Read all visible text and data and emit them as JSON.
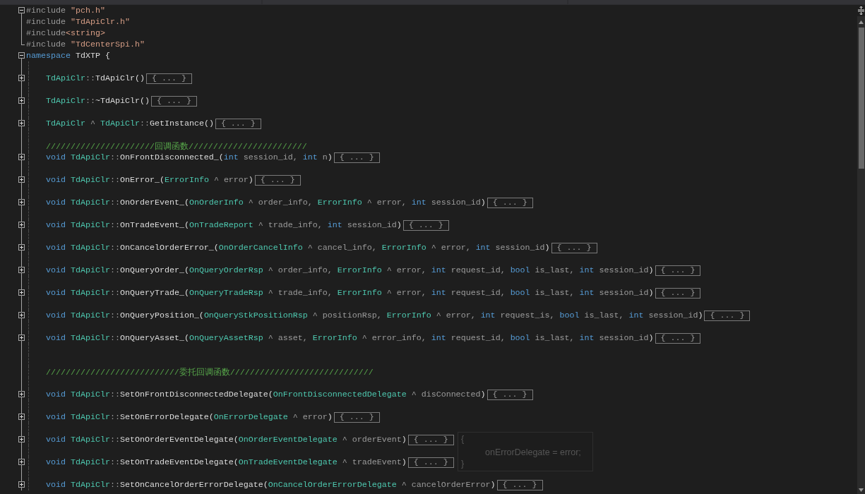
{
  "navigation_bar": {
    "dropdowns": [
      {
        "kind": "dropdown"
      },
      {
        "kind": "dropdown"
      },
      {
        "kind": "dropdown"
      }
    ]
  },
  "editor": {
    "lines": [
      {
        "kind": "fold",
        "expanded": true,
        "tokens": [
          {
            "kind": "directive",
            "text": "#include "
          },
          {
            "kind": "string",
            "text": "\"pch.h\""
          }
        ]
      },
      {
        "kind": "code",
        "tokens": [
          {
            "kind": "directive",
            "text": "#include "
          },
          {
            "kind": "string",
            "text": "\"TdApiClr.h\""
          }
        ]
      },
      {
        "kind": "code",
        "tokens": [
          {
            "kind": "directive",
            "text": "#include"
          },
          {
            "kind": "string",
            "text": "<string>"
          }
        ]
      },
      {
        "kind": "code",
        "tokens": [
          {
            "kind": "directive",
            "text": "#include "
          },
          {
            "kind": "string",
            "text": "\"TdCenterSpi.h\""
          }
        ]
      },
      {
        "kind": "fold",
        "expanded": true,
        "tokens": [
          {
            "kind": "keyword",
            "text": "namespace"
          },
          {
            "kind": "plain",
            "text": " TdXTP {"
          }
        ],
        "children": [
          {
            "kind": "blank"
          },
          {
            "kind": "fold",
            "expanded": false,
            "collapsed_text": "{ ... }",
            "tokens": [
              {
                "kind": "type",
                "text": "TdApiClr"
              },
              {
                "kind": "dim",
                "text": "::"
              },
              {
                "kind": "plain",
                "text": "TdApiClr()"
              }
            ]
          },
          {
            "kind": "blank"
          },
          {
            "kind": "fold",
            "expanded": false,
            "collapsed_text": "{ ... }",
            "tokens": [
              {
                "kind": "type",
                "text": "TdApiClr"
              },
              {
                "kind": "dim",
                "text": "::"
              },
              {
                "kind": "plain",
                "text": "~TdApiClr()"
              }
            ]
          },
          {
            "kind": "blank"
          },
          {
            "kind": "fold",
            "expanded": false,
            "collapsed_text": "{ ... }",
            "tokens": [
              {
                "kind": "type",
                "text": "TdApiClr"
              },
              {
                "kind": "dim",
                "text": " ^ "
              },
              {
                "kind": "type",
                "text": "TdApiClr"
              },
              {
                "kind": "dim",
                "text": "::"
              },
              {
                "kind": "plain",
                "text": "GetInstance()"
              }
            ]
          },
          {
            "kind": "blank"
          },
          {
            "kind": "code",
            "tokens": [
              {
                "kind": "comment",
                "text": "//////////////////////回调函数////////////////////////"
              }
            ]
          },
          {
            "kind": "fold",
            "expanded": false,
            "collapsed_text": "{ ... }",
            "tokens": [
              {
                "kind": "keyword",
                "text": "void "
              },
              {
                "kind": "type",
                "text": "TdApiClr"
              },
              {
                "kind": "dim",
                "text": "::"
              },
              {
                "kind": "plain",
                "text": "OnFrontDisconnected_("
              },
              {
                "kind": "keyword",
                "text": "int"
              },
              {
                "kind": "dim",
                "text": " session_id, "
              },
              {
                "kind": "keyword",
                "text": "int"
              },
              {
                "kind": "dim",
                "text": " n"
              },
              {
                "kind": "plain",
                "text": ")"
              }
            ]
          },
          {
            "kind": "blank"
          },
          {
            "kind": "fold",
            "expanded": false,
            "collapsed_text": "{ ... }",
            "tokens": [
              {
                "kind": "keyword",
                "text": "void "
              },
              {
                "kind": "type",
                "text": "TdApiClr"
              },
              {
                "kind": "dim",
                "text": "::"
              },
              {
                "kind": "plain",
                "text": "OnError_("
              },
              {
                "kind": "type",
                "text": "ErrorInfo"
              },
              {
                "kind": "dim",
                "text": " ^ error"
              },
              {
                "kind": "plain",
                "text": ")"
              }
            ]
          },
          {
            "kind": "blank"
          },
          {
            "kind": "fold",
            "expanded": false,
            "collapsed_text": "{ ... }",
            "tokens": [
              {
                "kind": "keyword",
                "text": "void "
              },
              {
                "kind": "type",
                "text": "TdApiClr"
              },
              {
                "kind": "dim",
                "text": "::"
              },
              {
                "kind": "plain",
                "text": "OnOrderEvent_("
              },
              {
                "kind": "type",
                "text": "OnOrderInfo"
              },
              {
                "kind": "dim",
                "text": " ^ order_info, "
              },
              {
                "kind": "type",
                "text": "ErrorInfo"
              },
              {
                "kind": "dim",
                "text": " ^ error, "
              },
              {
                "kind": "keyword",
                "text": "int"
              },
              {
                "kind": "dim",
                "text": " session_id"
              },
              {
                "kind": "plain",
                "text": ")"
              }
            ]
          },
          {
            "kind": "blank"
          },
          {
            "kind": "fold",
            "expanded": false,
            "collapsed_text": "{ ... }",
            "tokens": [
              {
                "kind": "keyword",
                "text": "void "
              },
              {
                "kind": "type",
                "text": "TdApiClr"
              },
              {
                "kind": "dim",
                "text": "::"
              },
              {
                "kind": "plain",
                "text": "OnTradeEvent_("
              },
              {
                "kind": "type",
                "text": "OnTradeReport"
              },
              {
                "kind": "dim",
                "text": " ^ trade_info, "
              },
              {
                "kind": "keyword",
                "text": "int"
              },
              {
                "kind": "dim",
                "text": " session_id"
              },
              {
                "kind": "plain",
                "text": ")"
              }
            ]
          },
          {
            "kind": "blank"
          },
          {
            "kind": "fold",
            "expanded": false,
            "collapsed_text": "{ ... }",
            "tokens": [
              {
                "kind": "keyword",
                "text": "void "
              },
              {
                "kind": "type",
                "text": "TdApiClr"
              },
              {
                "kind": "dim",
                "text": "::"
              },
              {
                "kind": "plain",
                "text": "OnCancelOrderError_("
              },
              {
                "kind": "type",
                "text": "OnOrderCancelInfo"
              },
              {
                "kind": "dim",
                "text": " ^ cancel_info, "
              },
              {
                "kind": "type",
                "text": "ErrorInfo"
              },
              {
                "kind": "dim",
                "text": " ^ error, "
              },
              {
                "kind": "keyword",
                "text": "int"
              },
              {
                "kind": "dim",
                "text": " session_id"
              },
              {
                "kind": "plain",
                "text": ")"
              }
            ]
          },
          {
            "kind": "blank"
          },
          {
            "kind": "fold",
            "expanded": false,
            "collapsed_text": "{ ... }",
            "tokens": [
              {
                "kind": "keyword",
                "text": "void "
              },
              {
                "kind": "type",
                "text": "TdApiClr"
              },
              {
                "kind": "dim",
                "text": "::"
              },
              {
                "kind": "plain",
                "text": "OnQueryOrder_("
              },
              {
                "kind": "type",
                "text": "OnQueryOrderRsp"
              },
              {
                "kind": "dim",
                "text": " ^ order_info, "
              },
              {
                "kind": "type",
                "text": "ErrorInfo"
              },
              {
                "kind": "dim",
                "text": " ^ error, "
              },
              {
                "kind": "keyword",
                "text": "int"
              },
              {
                "kind": "dim",
                "text": " request_id, "
              },
              {
                "kind": "keyword",
                "text": "bool"
              },
              {
                "kind": "dim",
                "text": " is_last, "
              },
              {
                "kind": "keyword",
                "text": "int"
              },
              {
                "kind": "dim",
                "text": " session_id"
              },
              {
                "kind": "plain",
                "text": ")"
              }
            ]
          },
          {
            "kind": "blank"
          },
          {
            "kind": "fold",
            "expanded": false,
            "collapsed_text": "{ ... }",
            "tokens": [
              {
                "kind": "keyword",
                "text": "void "
              },
              {
                "kind": "type",
                "text": "TdApiClr"
              },
              {
                "kind": "dim",
                "text": "::"
              },
              {
                "kind": "plain",
                "text": "OnQueryTrade_("
              },
              {
                "kind": "type",
                "text": "OnQueryTradeRsp"
              },
              {
                "kind": "dim",
                "text": " ^ trade_info, "
              },
              {
                "kind": "type",
                "text": "ErrorInfo"
              },
              {
                "kind": "dim",
                "text": " ^ error, "
              },
              {
                "kind": "keyword",
                "text": "int"
              },
              {
                "kind": "dim",
                "text": " request_id, "
              },
              {
                "kind": "keyword",
                "text": "bool"
              },
              {
                "kind": "dim",
                "text": " is_last, "
              },
              {
                "kind": "keyword",
                "text": "int"
              },
              {
                "kind": "dim",
                "text": " session_id"
              },
              {
                "kind": "plain",
                "text": ")"
              }
            ]
          },
          {
            "kind": "blank"
          },
          {
            "kind": "fold",
            "expanded": false,
            "collapsed_text": "{ ... }",
            "tokens": [
              {
                "kind": "keyword",
                "text": "void "
              },
              {
                "kind": "type",
                "text": "TdApiClr"
              },
              {
                "kind": "dim",
                "text": "::"
              },
              {
                "kind": "plain",
                "text": "OnQueryPosition_("
              },
              {
                "kind": "type",
                "text": "OnQueryStkPositionRsp"
              },
              {
                "kind": "dim",
                "text": " ^ positionRsp, "
              },
              {
                "kind": "type",
                "text": "ErrorInfo"
              },
              {
                "kind": "dim",
                "text": " ^ error, "
              },
              {
                "kind": "keyword",
                "text": "int"
              },
              {
                "kind": "dim",
                "text": " request_is, "
              },
              {
                "kind": "keyword",
                "text": "bool"
              },
              {
                "kind": "dim",
                "text": " is_last, "
              },
              {
                "kind": "keyword",
                "text": "int"
              },
              {
                "kind": "dim",
                "text": " session_id"
              },
              {
                "kind": "plain",
                "text": ")"
              }
            ]
          },
          {
            "kind": "blank"
          },
          {
            "kind": "fold",
            "expanded": false,
            "collapsed_text": "{ ... }",
            "tokens": [
              {
                "kind": "keyword",
                "text": "void "
              },
              {
                "kind": "type",
                "text": "TdApiClr"
              },
              {
                "kind": "dim",
                "text": "::"
              },
              {
                "kind": "plain",
                "text": "OnQueryAsset_("
              },
              {
                "kind": "type",
                "text": "OnQueryAssetRsp"
              },
              {
                "kind": "dim",
                "text": " ^ asset, "
              },
              {
                "kind": "type",
                "text": "ErrorInfo"
              },
              {
                "kind": "dim",
                "text": " ^ error_info, "
              },
              {
                "kind": "keyword",
                "text": "int"
              },
              {
                "kind": "dim",
                "text": " request_id, "
              },
              {
                "kind": "keyword",
                "text": "bool"
              },
              {
                "kind": "dim",
                "text": " is_last, "
              },
              {
                "kind": "keyword",
                "text": "int"
              },
              {
                "kind": "dim",
                "text": " session_id"
              },
              {
                "kind": "plain",
                "text": ")"
              }
            ]
          },
          {
            "kind": "blank"
          },
          {
            "kind": "blank"
          },
          {
            "kind": "code",
            "tokens": [
              {
                "kind": "comment",
                "text": "///////////////////////////委托回调函数/////////////////////////////"
              }
            ]
          },
          {
            "kind": "blank"
          },
          {
            "kind": "fold",
            "expanded": false,
            "collapsed_text": "{ ... }",
            "tokens": [
              {
                "kind": "keyword",
                "text": "void "
              },
              {
                "kind": "type",
                "text": "TdApiClr"
              },
              {
                "kind": "dim",
                "text": "::"
              },
              {
                "kind": "plain",
                "text": "SetOnFrontDisconnectedDelegate("
              },
              {
                "kind": "type",
                "text": "OnFrontDisconnectedDelegate"
              },
              {
                "kind": "dim",
                "text": " ^ disConnected"
              },
              {
                "kind": "plain",
                "text": ")"
              }
            ]
          },
          {
            "kind": "blank"
          },
          {
            "kind": "fold",
            "expanded": false,
            "collapsed_text": "{ ... }",
            "tokens": [
              {
                "kind": "keyword",
                "text": "void "
              },
              {
                "kind": "type",
                "text": "TdApiClr"
              },
              {
                "kind": "dim",
                "text": "::"
              },
              {
                "kind": "plain",
                "text": "SetOnErrorDelegate("
              },
              {
                "kind": "type",
                "text": "OnErrorDelegate"
              },
              {
                "kind": "dim",
                "text": " ^ error"
              },
              {
                "kind": "plain",
                "text": ")"
              }
            ]
          },
          {
            "kind": "blank"
          },
          {
            "kind": "fold",
            "expanded": false,
            "collapsed_text": "{ ... }",
            "tokens": [
              {
                "kind": "keyword",
                "text": "void "
              },
              {
                "kind": "type",
                "text": "TdApiClr"
              },
              {
                "kind": "dim",
                "text": "::"
              },
              {
                "kind": "plain",
                "text": "SetOnOrderEventDelegate("
              },
              {
                "kind": "type",
                "text": "OnOrderEventDelegate"
              },
              {
                "kind": "dim",
                "text": " ^ orderEvent"
              },
              {
                "kind": "plain",
                "text": ")"
              }
            ]
          },
          {
            "kind": "blank"
          },
          {
            "kind": "fold",
            "expanded": false,
            "collapsed_text": "{ ... }",
            "tokens": [
              {
                "kind": "keyword",
                "text": "void "
              },
              {
                "kind": "type",
                "text": "TdApiClr"
              },
              {
                "kind": "dim",
                "text": "::"
              },
              {
                "kind": "plain",
                "text": "SetOnTradeEventDelegate("
              },
              {
                "kind": "type",
                "text": "OnTradeEventDelegate"
              },
              {
                "kind": "dim",
                "text": " ^ tradeEvent"
              },
              {
                "kind": "plain",
                "text": ")"
              }
            ]
          },
          {
            "kind": "blank"
          },
          {
            "kind": "fold",
            "expanded": false,
            "collapsed_text": "{ ... }",
            "tokens": [
              {
                "kind": "keyword",
                "text": "void "
              },
              {
                "kind": "type",
                "text": "TdApiClr"
              },
              {
                "kind": "dim",
                "text": "::"
              },
              {
                "kind": "plain",
                "text": "SetOnCancelOrderErrorDelegate("
              },
              {
                "kind": "type",
                "text": "OnCancelOrderErrorDelegate"
              },
              {
                "kind": "dim",
                "text": " ^ cancelOrderError"
              },
              {
                "kind": "plain",
                "text": ")"
              }
            ]
          }
        ]
      }
    ]
  },
  "peek_tooltip": {
    "lines": [
      "{",
      "onErrorDelegate = error;",
      "}"
    ]
  }
}
